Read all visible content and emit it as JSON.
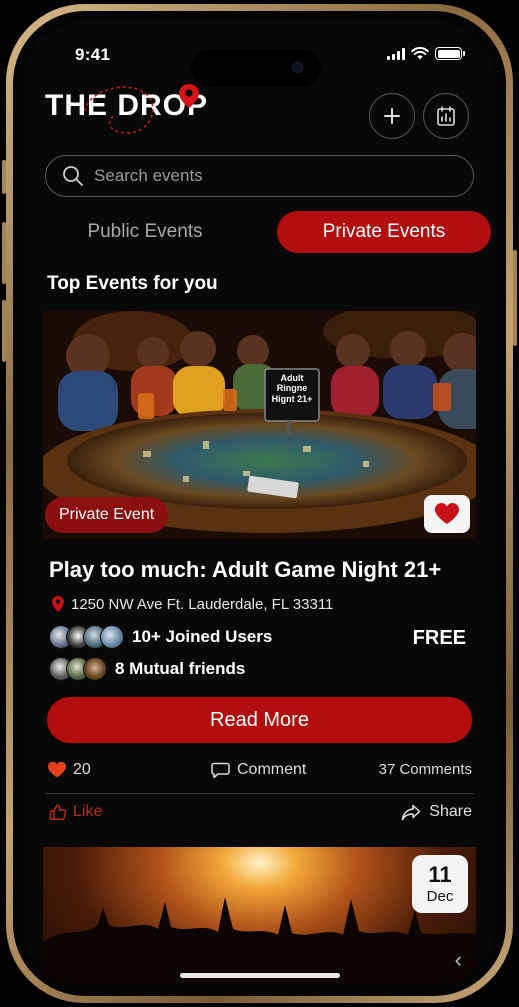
{
  "status_bar": {
    "time": "9:41"
  },
  "header": {
    "logo": "THE DROP",
    "add_icon": "plus-icon",
    "calendar_icon": "calendar-icon"
  },
  "search": {
    "placeholder": "Search events",
    "value": ""
  },
  "tabs": [
    {
      "label": "Public Events",
      "active": false
    },
    {
      "label": "Private Events",
      "active": true
    }
  ],
  "section_title": "Top Events for you",
  "colors": {
    "accent": "#b30e0e",
    "background": "#080808",
    "like": "#b52b1a"
  },
  "event": {
    "badge": "Private Event",
    "sign_text": "Adult Ringne Hignt 21+",
    "title": "Play too much: Adult Game Night 21+",
    "location": "1250 NW Ave Ft. Lauderdale, FL 33311",
    "joined": "10+ Joined Users",
    "mutual": "8 Mutual friends",
    "price": "FREE",
    "cta": "Read More",
    "likes": "20",
    "comment_label": "Comment",
    "comments_count": "37 Comments",
    "like_label": "Like",
    "share_label": "Share",
    "favorited": true
  },
  "event2": {
    "day": "11",
    "month": "Dec"
  }
}
